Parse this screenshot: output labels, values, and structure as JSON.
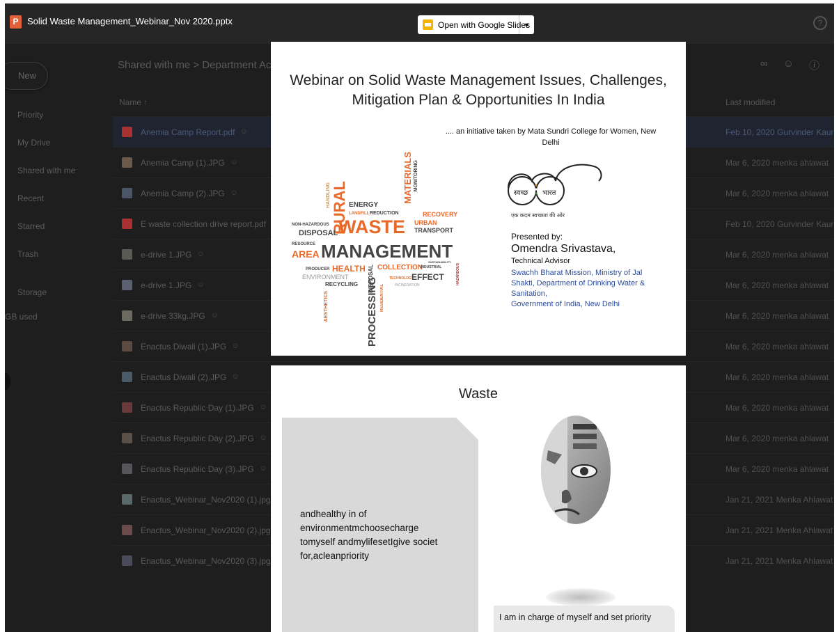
{
  "topbar": {
    "file_name": "Solid Waste Management_Webinar_Nov 2020.pptx",
    "file_icon_letter": "P",
    "open_with_label": "Open with Google Slides",
    "help_label": "?"
  },
  "drive": {
    "new_label": "New",
    "nav": [
      "Priority",
      "My Drive",
      "Shared with me",
      "Recent",
      "Starred",
      "Trash",
      "Storage",
      "GB used"
    ],
    "breadcrumb": "Shared with me  >  Department Ac",
    "column_name": "Name",
    "column_modified": "Last modified",
    "files": [
      {
        "name": "Anemia Camp Report.pdf",
        "modified": "Feb 10, 2020 Gurvinder Kaur",
        "thumb_color": "#a83232",
        "selected": true
      },
      {
        "name": "Anemia Camp (1).JPG",
        "modified": "Mar 6, 2020 menka ahlawat",
        "thumb_color": "#6b5a4a"
      },
      {
        "name": "Anemia Camp (2).JPG",
        "modified": "Mar 6, 2020 menka ahlawat",
        "thumb_color": "#4a5668"
      },
      {
        "name": "E waste collection drive report.pdf",
        "modified": "Feb 10, 2020 Gurvinder Kaur",
        "thumb_color": "#a83232"
      },
      {
        "name": "e-drive 1.JPG",
        "modified": "Mar 6, 2020 menka ahlawat",
        "thumb_color": "#5a5a55"
      },
      {
        "name": "e-drive 1.JPG",
        "modified": "Mar 6, 2020 menka ahlawat",
        "thumb_color": "#5a6070"
      },
      {
        "name": "e-drive 33kg.JPG",
        "modified": "Mar 6, 2020 menka ahlawat",
        "thumb_color": "#6a6a60"
      },
      {
        "name": "Enactus Diwali (1).JPG",
        "modified": "Mar 6, 2020 menka ahlawat",
        "thumb_color": "#5a4a40"
      },
      {
        "name": "Enactus Diwali (2).JPG",
        "modified": "Mar 6, 2020 menka ahlawat",
        "thumb_color": "#4a5a66"
      },
      {
        "name": "Enactus Republic Day (1).JPG",
        "modified": "Mar 6, 2020 menka ahlawat",
        "thumb_color": "#6a3a3a"
      },
      {
        "name": "Enactus Republic Day (2).JPG",
        "modified": "Mar 6, 2020 menka ahlawat",
        "thumb_color": "#5a5048"
      },
      {
        "name": "Enactus Republic Day (3).JPG",
        "modified": "Mar 6, 2020 menka ahlawat",
        "thumb_color": "#55555a"
      },
      {
        "name": "Enactus_Webinar_Nov2020 (1).jpg",
        "modified": "Jan 21, 2021 Menka Ahlawat",
        "thumb_color": "#5a6a6a"
      },
      {
        "name": "Enactus_Webinar_Nov2020 (2).jpg",
        "modified": "Jan 21, 2021 Menka Ahlawat",
        "thumb_color": "#6a4a4a"
      },
      {
        "name": "Enactus_Webinar_Nov2020 (3).jpg",
        "modified": "Jan 21, 2021 Menka Ahlawat",
        "thumb_color": "#4a4a5a"
      }
    ]
  },
  "slide1": {
    "title_line1": "Webinar on Solid Waste Management Issues, Challenges,",
    "title_line2": "Mitigation Plan & Opportunities In India",
    "initiative_line1": ".... an initiative taken by Mata Sundri College for Women, New",
    "initiative_line2": "Delhi",
    "logo_text_left": "स्वच्छ",
    "logo_text_right": "भारत",
    "logo_caption": "एक कदम स्वच्छता की ओर",
    "presented_by": "Presented by:",
    "presenter": "Omendra Srivastava,",
    "role": "Technical Advisor",
    "org_lines": [
      "Swachh Bharat Mission, Ministry of Jal",
      "Shakti, Department of Drinking Water &",
      "Sanitation,",
      "Government of India, New Delhi"
    ],
    "cloud_words": {
      "waste": "WASTE",
      "management": "MANAGEMENT",
      "area": "AREA",
      "rural": "RURAL",
      "energy": "ENERGY",
      "landfill": "LANDFILL",
      "reduction": "REDUCTION",
      "disposal": "DISPOSAL",
      "nonhaz": "NON-HAZARDOUS",
      "handling": "HANDLING",
      "materials": "MATERIALS",
      "monitoring": "MONITORING",
      "recovery": "RECOVERY",
      "urban": "URBAN",
      "transport": "TRANSPORT",
      "resource": "RESOURCE",
      "producer": "PRODUCER",
      "health": "HEALTH",
      "collection": "COLLECTION",
      "industrial": "INDUSTRIAL",
      "sustainability": "SUSTAINABILITY",
      "environment": "ENVIRONMENT",
      "recycling": "RECYCLING",
      "processing": "PROCESSING",
      "residential": "RESIDENTIAL",
      "aesthetics": "AESTHETICS",
      "technology": "TECHNOLOGY",
      "effect": "EFFECT",
      "incineration": "INCINERATION",
      "hazardous": "HAZARDOUS",
      "disposal_v": "DISPOSAL"
    }
  },
  "slide2": {
    "title": "Waste",
    "box_text_lines": [
      "andhealthy in of",
      "environmentmchoosecharge",
      "tomyself andmylifesetIgive societ",
      "for,acleanpriority"
    ],
    "caption": "I am in charge of myself and set priority"
  },
  "colors": {
    "waste_orange": "#e8692a",
    "cloud_gray": "#555555",
    "org_blue": "#2e4d9c",
    "slides_yellow": "#f4b400"
  }
}
